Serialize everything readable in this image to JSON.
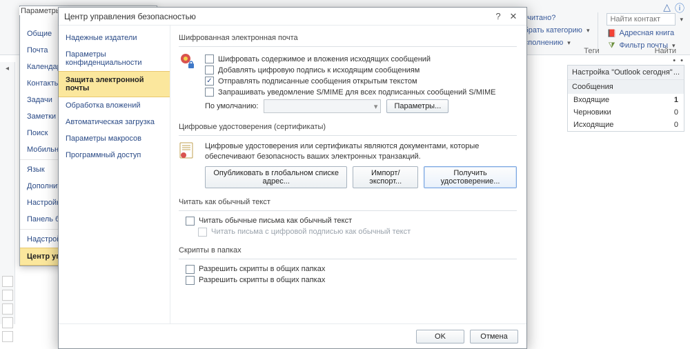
{
  "titlebar": {
    "help": "?",
    "close": "✕",
    "minimize": "▢",
    "info_icon": "ⓘ"
  },
  "ribbon": {
    "left": [
      {
        "icon": "flag",
        "label": "Прочитано?"
      },
      {
        "icon": "tag",
        "label": "Выбрать категорию"
      },
      {
        "icon": "flag2",
        "label": "К исполнению"
      }
    ],
    "right": [
      {
        "icon": "book",
        "label": "Адресная книга"
      },
      {
        "icon": "filter",
        "label": "Фильтр почты"
      }
    ],
    "find_placeholder": "Найти контакт",
    "group_tags": "Теги",
    "group_find": "Найти"
  },
  "options_dialog": {
    "title": "Параметры O",
    "items": [
      "Общие",
      "Почта",
      "Календарь",
      "Контакты",
      "Задачи",
      "Заметки и д",
      "Поиск",
      "Мобильные",
      "Язык",
      "Дополнител",
      "Настройка л",
      "Панель быст",
      "Надстройки",
      "Центр управ"
    ],
    "selected_index": 13
  },
  "trust": {
    "title": "Центр управления безопасностью",
    "help": "?",
    "close": "✕",
    "nav": [
      "Надежные издатели",
      "Параметры конфиденциальности",
      "Защита электронной почты",
      "Обработка вложений",
      "Автоматическая загрузка",
      "Параметры макросов",
      "Программный доступ"
    ],
    "nav_selected": 2,
    "g1": {
      "title": "Шифрованная электронная почта",
      "c1": "Шифровать содержимое и вложения исходящих сообщений",
      "c2": "Добавлять цифровую подпись к исходящим сообщениям",
      "c3": "Отправлять подписанные сообщения открытым текстом",
      "c4": "Запрашивать уведомление S/MIME для всех подписанных сообщений S/MIME",
      "default_label": "По умолчанию:",
      "params_btn": "Параметры..."
    },
    "g2": {
      "title": "Цифровые удостоверения (сертификаты)",
      "desc": "Цифровые удостоверения или сертификаты являются документами, которые обеспечивают безопасность ваших электронных транзакций.",
      "b1": "Опубликовать в глобальном списке адрес...",
      "b2": "Импорт/экспорт...",
      "b3": "Получить удостоверение..."
    },
    "g3": {
      "title": "Читать как обычный текст",
      "c1": "Читать обычные письма как обычный текст",
      "c2": "Читать письма с цифровой подписью как обычный текст"
    },
    "g4": {
      "title": "Скрипты в папках",
      "c1": "Разрешить скрипты в общих папках",
      "c2": "Разрешить скрипты в общих папках"
    },
    "ok": "OK",
    "cancel": "Отмена"
  },
  "today": {
    "title": "Настройка \"Outlook сегодня\" ",
    "dots": "...",
    "section": "Сообщения",
    "rows": [
      {
        "label": "Входящие",
        "val": "1",
        "bold": true
      },
      {
        "label": "Черновики",
        "val": "0"
      },
      {
        "label": "Исходящие",
        "val": "0"
      }
    ]
  }
}
